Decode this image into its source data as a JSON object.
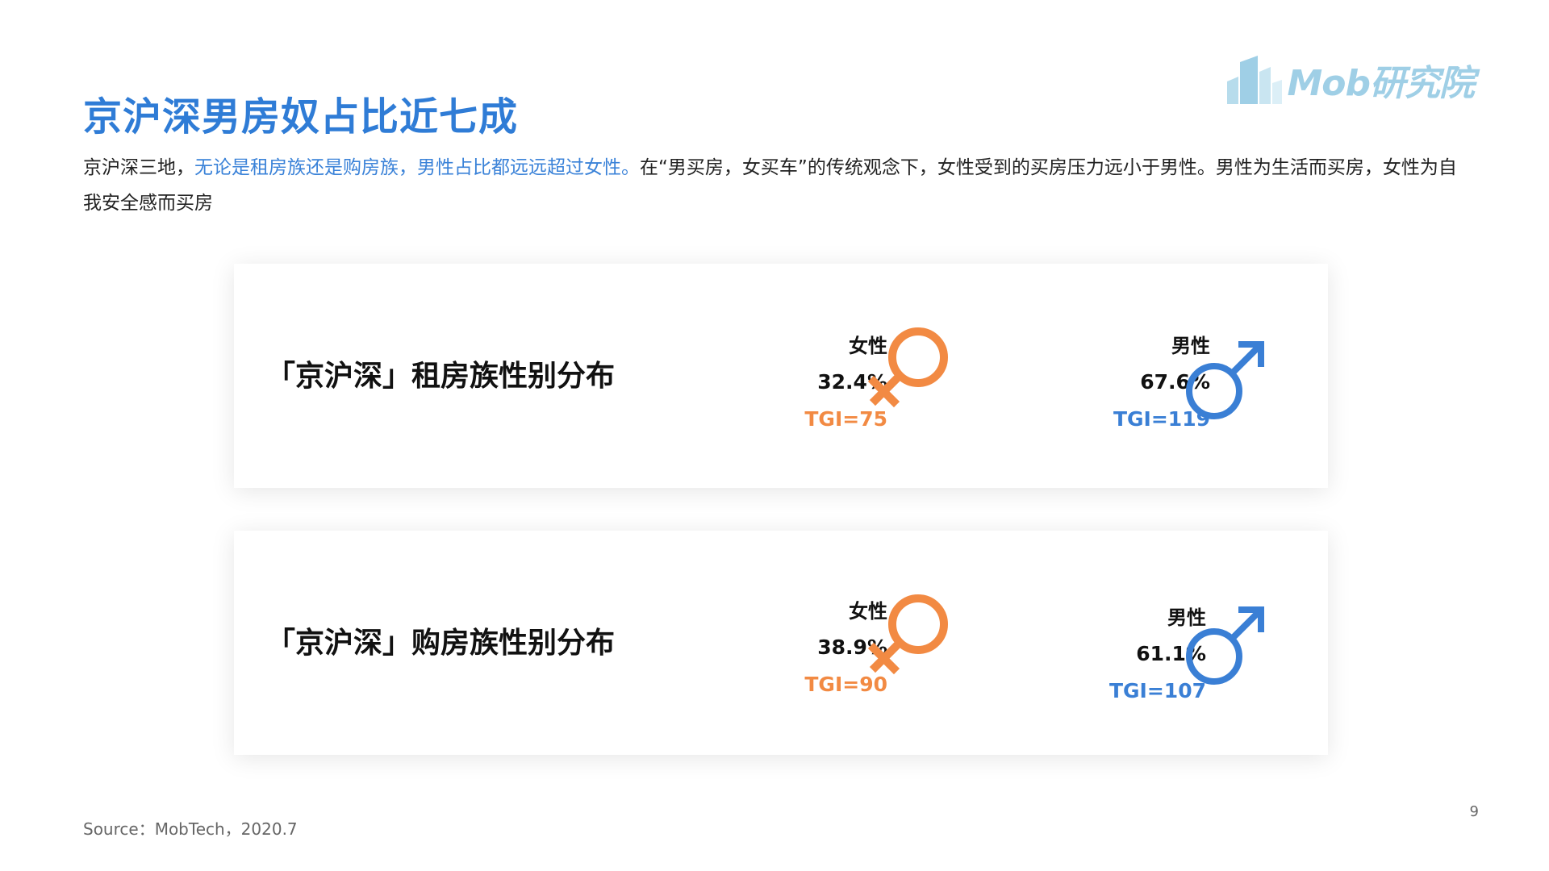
{
  "header": {
    "title": "京沪深男房奴占比近七成",
    "logo_text": "Mob研究院"
  },
  "description": {
    "part1": "京沪深三地，",
    "highlight": "无论是租房族还是购房族，男性占比都远远超过女性。",
    "part2": "在“男买房，女买车”的传统观念下，女性受到的买房压力远小于男性。男性为生活而买房，女性为自我安全感而买房"
  },
  "cards": [
    {
      "title": "「京沪深」租房族性别分布",
      "female": {
        "label": "女性",
        "percent": "32.4%",
        "tgi": "TGI=75",
        "share": 32.4
      },
      "male": {
        "label": "男性",
        "percent": "67.6%",
        "tgi": "TGI=119",
        "share": 67.6
      }
    },
    {
      "title": "「京沪深」购房族性别分布",
      "female": {
        "label": "女性",
        "percent": "38.9%",
        "tgi": "TGI=90",
        "share": 38.9
      },
      "male": {
        "label": "男性",
        "percent": "61.1%",
        "tgi": "TGI=107",
        "share": 61.1
      }
    }
  ],
  "icons": {
    "female": "female-symbol-icon",
    "male": "male-symbol-icon",
    "logo": "mob-logo-icon"
  },
  "colors": {
    "title": "#2f7cd6",
    "highlight": "#3a82d8",
    "female": "#f28a43",
    "male": "#3a7fd5",
    "logo": "#9fcfe6"
  },
  "footer": {
    "source": "Source：MobTech，2020.7",
    "page_number": "9"
  }
}
